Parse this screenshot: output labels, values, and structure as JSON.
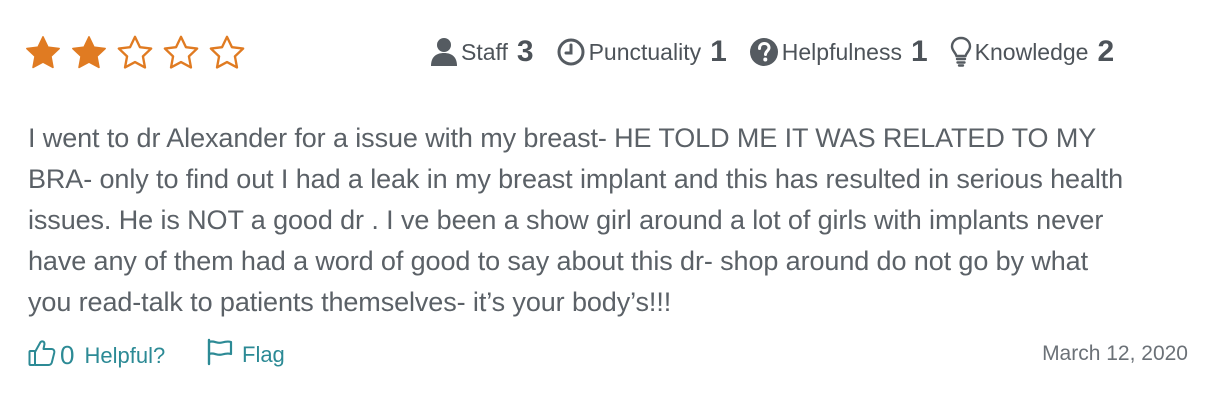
{
  "review": {
    "star_rating": 2,
    "star_max": 5,
    "star_color": "#e07b22",
    "ratings": [
      {
        "icon": "user-icon",
        "label": "Staff",
        "value": "3"
      },
      {
        "icon": "clock-icon",
        "label": "Punctuality",
        "value": "1"
      },
      {
        "icon": "question-circle-icon",
        "label": "Helpfulness",
        "value": "1"
      },
      {
        "icon": "lightbulb-icon",
        "label": "Knowledge",
        "value": "2"
      }
    ],
    "text_lines": [
      "I went to dr Alexander for a issue with my breast- HE TOLD ME IT WAS RELATED TO MY",
      "BRA- only to find out I had a leak in my breast implant and this has resulted in serious health",
      "issues. He is NOT a good dr . I ve been a show girl around a lot of girls with implants never",
      "have any of them had a word of good to say about this dr- shop around do not go by what",
      "you read-talk to patients themselves- it’s your body’s!!!"
    ],
    "helpful_count": "0",
    "helpful_label": "Helpful?",
    "flag_label": "Flag",
    "date": "March 12, 2020",
    "accent_color": "#2c8a95"
  }
}
